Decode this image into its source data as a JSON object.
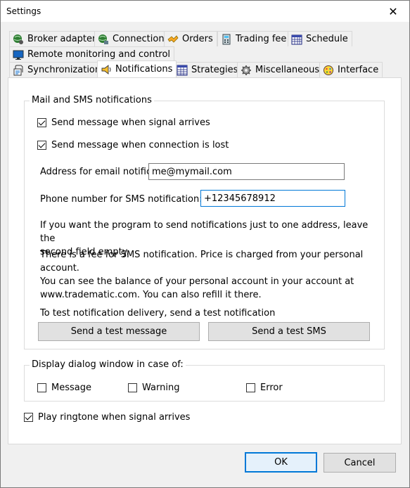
{
  "window": {
    "title": "Settings",
    "close_glyph": "✕"
  },
  "tabs": {
    "row1": [
      {
        "label": "Broker adapter",
        "icon": "broker-adapter-icon"
      },
      {
        "label": "Connection",
        "icon": "connection-icon"
      },
      {
        "label": "Orders",
        "icon": "orders-icon"
      },
      {
        "label": "Trading fee",
        "icon": "trading-fee-icon"
      },
      {
        "label": "Schedule",
        "icon": "schedule-icon"
      }
    ],
    "row2": [
      {
        "label": "Remote monitoring and control",
        "icon": "remote-monitoring-icon"
      }
    ],
    "row3": [
      {
        "label": "Synchronization",
        "icon": "synchronization-icon"
      },
      {
        "label": "Notifications",
        "icon": "notifications-icon",
        "active": true
      },
      {
        "label": "Strategies",
        "icon": "strategies-icon"
      },
      {
        "label": "Miscellaneous",
        "icon": "miscellaneous-icon"
      },
      {
        "label": "Interface",
        "icon": "interface-icon"
      }
    ]
  },
  "mail_group": {
    "label": "Mail and SMS notifications",
    "send_on_signal": {
      "label": "Send message when signal arrives",
      "checked": true
    },
    "send_on_connection_lost": {
      "label": "Send message when connection is lost",
      "checked": true
    },
    "email_label": "Address for email notifica",
    "email_value": "me@mymail.com",
    "phone_label": "Phone number for SMS notification:",
    "phone_value": "+12345678912",
    "info1_line1": "If you want the program to send notifications just to one address, leave the",
    "info1_line2": "second field empty.",
    "info2_line1": "There is a fee for SMS notification. Price is charged from your personal",
    "info2_line2": "account.",
    "info2_line3": "You can see the balance of your personal account in your account at",
    "info2_line4": "www.tradematic.com. You can also refill it there.",
    "test_text": "To test notification delivery, send a test notification",
    "test_message_button": "Send a test message",
    "test_sms_button": "Send a test SMS"
  },
  "display_group": {
    "label": "Display dialog window in case of:",
    "message": {
      "label": "Message",
      "checked": false
    },
    "warning": {
      "label": "Warning",
      "checked": false
    },
    "error": {
      "label": "Error",
      "checked": false
    }
  },
  "play_ringtone": {
    "label": "Play ringtone when signal arrives",
    "checked": true
  },
  "footer": {
    "ok": "OK",
    "cancel": "Cancel"
  },
  "colors": {
    "accent": "#0078d7",
    "background": "#f0f0f0",
    "panel": "#ffffff"
  }
}
